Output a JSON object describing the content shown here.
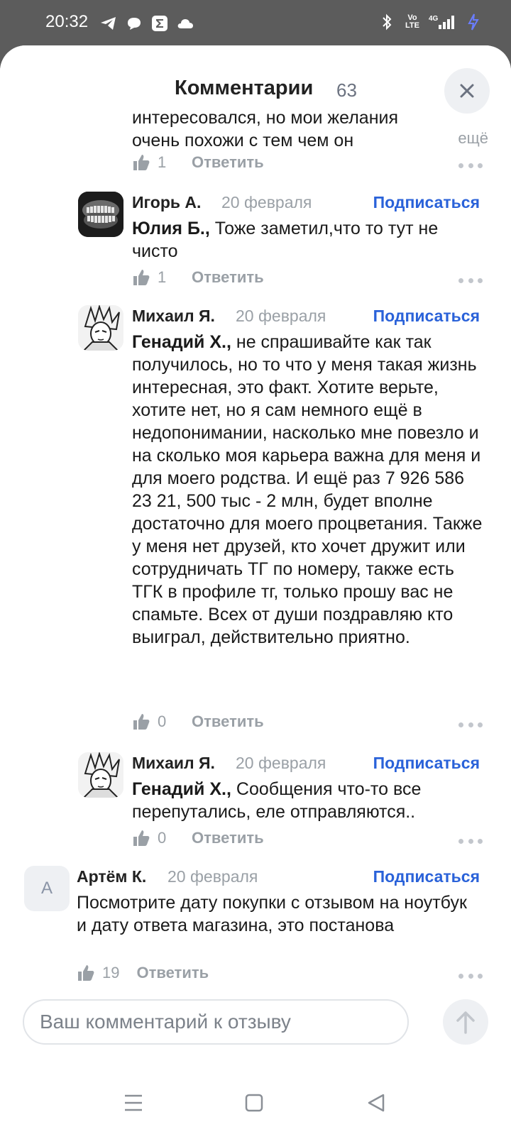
{
  "status": {
    "time": "20:32",
    "left_icons": [
      "telegram-icon",
      "chat-bubble-icon",
      "sigma-icon",
      "cloud-icon"
    ],
    "right_icons": [
      "bluetooth-icon",
      "volte-icon",
      "signal-4g-icon",
      "charging-icon"
    ],
    "volte_label": "Vo LTE",
    "net_label": "4G"
  },
  "sheet": {
    "title": "Комментарии",
    "count": "63",
    "close_icon": "close-icon"
  },
  "partial_comment": {
    "text_line1": "интересовался, но мои желания",
    "text_line2": "очень похожи с тем чем он",
    "more": "ещё",
    "likes": "1",
    "reply": "Ответить"
  },
  "comments": [
    {
      "author": "Игорь А.",
      "date": "20 февраля",
      "subscribe": "Подписаться",
      "mention": "Юлия Б.,",
      "text": " Тоже заметил,что то тут не чисто",
      "likes": "1",
      "reply": "Ответить",
      "avatar": "xray-avatar"
    },
    {
      "author": "Михаил Я.",
      "date": "20 февраля",
      "subscribe": "Подписаться",
      "mention": "Генадий Х.,",
      "text": " не спрашивайте как так получилось, но то что у меня такая жизнь интересная, это факт. Хотите верьте, хотите нет, но я сам немного ещё в недопонимании, насколько мне повезло и на сколько моя карьера важна для меня и для моего родства. И ещё раз 7 926 586 23 21, 500 тыс - 2 млн, будет вполне достаточно для моего процветания. Также у меня нет друзей, кто хочет дружит или сотрудничать ТГ по номеру, также есть ТГК в профиле тг, только прошу вас не спамьте. Всех от души поздравляю кто выиграл, действительно приятно.",
      "likes": "0",
      "reply": "Ответить",
      "avatar": "anime-avatar"
    },
    {
      "author": "Михаил Я.",
      "date": "20 февраля",
      "subscribe": "Подписаться",
      "mention": "Генадий Х.,",
      "text": " Сообщения что-то все перепутались, еле отправляются..",
      "likes": "0",
      "reply": "Ответить",
      "avatar": "anime-avatar"
    },
    {
      "author": "Артём К.",
      "date": "20 февраля",
      "subscribe": "Подписаться",
      "mention": "",
      "text": "Посмотрите дату покупки с отзывом на ноутбук и дату ответа магазина, это постанова",
      "likes": "19",
      "reply": "Ответить",
      "avatar_letter": "А"
    }
  ],
  "composer": {
    "placeholder": "Ваш комментарий к отзыву",
    "value": "",
    "send_icon": "arrow-up-icon"
  },
  "navbar": {
    "icons": [
      "menu-icon",
      "home-square-icon",
      "back-triangle-icon"
    ]
  },
  "colors": {
    "accent": "#2a62d9",
    "muted": "#9aa0a6",
    "status_bg": "#5c5c5c"
  }
}
